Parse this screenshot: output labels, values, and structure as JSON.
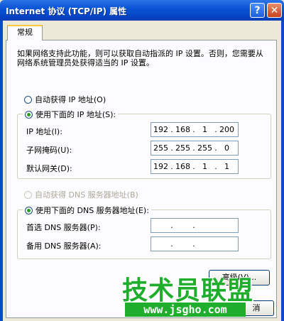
{
  "window": {
    "title": "Internet 协议 (TCP/IP) 属性",
    "help_glyph": "?",
    "close_glyph": "✕"
  },
  "tabs": [
    {
      "label": "常规"
    }
  ],
  "description": "如果网络支持此功能，则可以获取自动指派的 IP 设置。否则，您需要从网络系统管理员处获得适当的 IP 设置。",
  "ip": {
    "auto_label": "自动获得 IP 地址(O)",
    "manual_label": "使用下面的 IP 地址(S):",
    "selected": "manual",
    "fields": [
      {
        "label": "IP 地址(I):",
        "octets": [
          "192",
          "168",
          "1",
          "200"
        ]
      },
      {
        "label": "子网掩码(U):",
        "octets": [
          "255",
          "255",
          "255",
          "0"
        ]
      },
      {
        "label": "默认网关(D):",
        "octets": [
          "192",
          "168",
          "1",
          "1"
        ]
      }
    ]
  },
  "dns": {
    "auto_label": "自动获得 DNS 服务器地址(B)",
    "manual_label": "使用下面的 DNS 服务器地址(E):",
    "selected": "manual",
    "fields": [
      {
        "label": "首选 DNS 服务器(P):",
        "octets": [
          "",
          "",
          "",
          ""
        ]
      },
      {
        "label": "备用 DNS 服务器(A):",
        "octets": [
          "",
          "",
          "",
          ""
        ]
      }
    ]
  },
  "buttons": {
    "advanced": "高级(V)...",
    "cancel": "消"
  },
  "watermark": {
    "brand": "技术员联盟",
    "url": "www.jsgho.com"
  },
  "colors": {
    "titlebar": "#0a55d6",
    "radio_dot": "#21a121",
    "watermark": "#1fae2c"
  }
}
